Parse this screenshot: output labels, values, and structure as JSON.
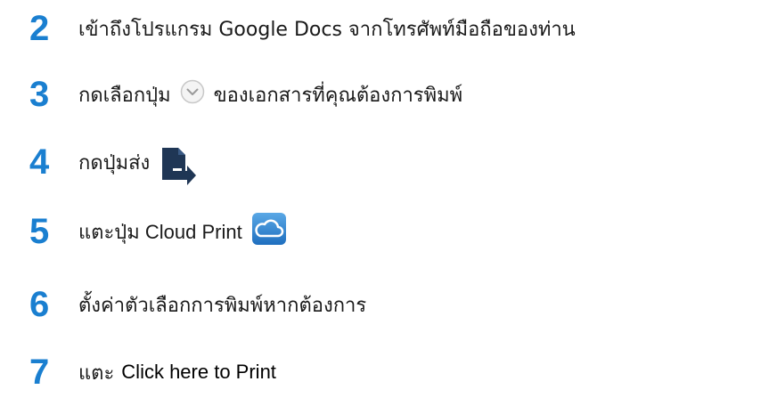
{
  "colors": {
    "step_number": "#1a7fd0",
    "text": "#1a1a1a",
    "send_icon": "#1f3655",
    "cloud_icon_bg": "#2f86d2"
  },
  "steps": [
    {
      "number": "2",
      "text": "เข้าถึงโปรแกรม Google Docs จากโทรศัพท์มือถือของท่าน"
    },
    {
      "number": "3",
      "text_before": "กดเลือกปุ่ม",
      "icon": "dropdown-circle-icon",
      "text_after": "ของเอกสารที่คุณต้องการพิมพ์"
    },
    {
      "number": "4",
      "text_before": "กดปุ่มส่ง",
      "icon": "send-document-icon"
    },
    {
      "number": "5",
      "text_before": "แตะปุ่ม Cloud Print",
      "icon": "cloud-print-icon"
    },
    {
      "number": "6",
      "text": "ตั้งค่าตัวเลือกการพิมพ์หากต้องการ"
    },
    {
      "number": "7",
      "text_before": "แตะ",
      "link": "Click here to Print"
    }
  ]
}
